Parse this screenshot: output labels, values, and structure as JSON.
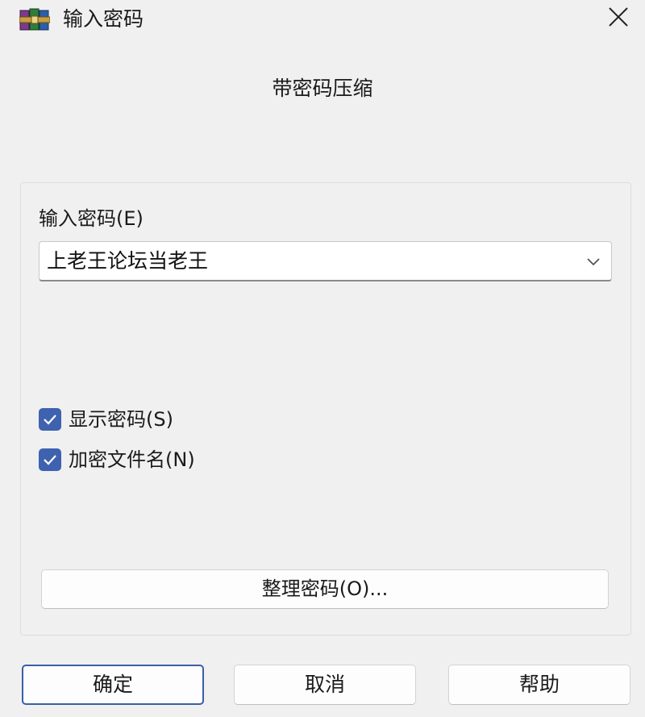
{
  "window": {
    "title": "输入密码",
    "app_icon": "winrar-books-icon",
    "close_icon": "close-icon"
  },
  "header": {
    "caption": "带密码压缩"
  },
  "password": {
    "label": "输入密码(E)",
    "value": "上老王论坛当老王",
    "dropdown_icon": "chevron-down-icon"
  },
  "options": [
    {
      "label": "显示密码(S)",
      "checked": true
    },
    {
      "label": "加密文件名(N)",
      "checked": true
    }
  ],
  "manage_button": {
    "label": "整理密码(O)..."
  },
  "buttons": {
    "ok": "确定",
    "cancel": "取消",
    "help": "帮助"
  },
  "colors": {
    "accent": "#3f62b0",
    "background": "#f0f0f0",
    "default_button_border": "#3a5ea8"
  }
}
